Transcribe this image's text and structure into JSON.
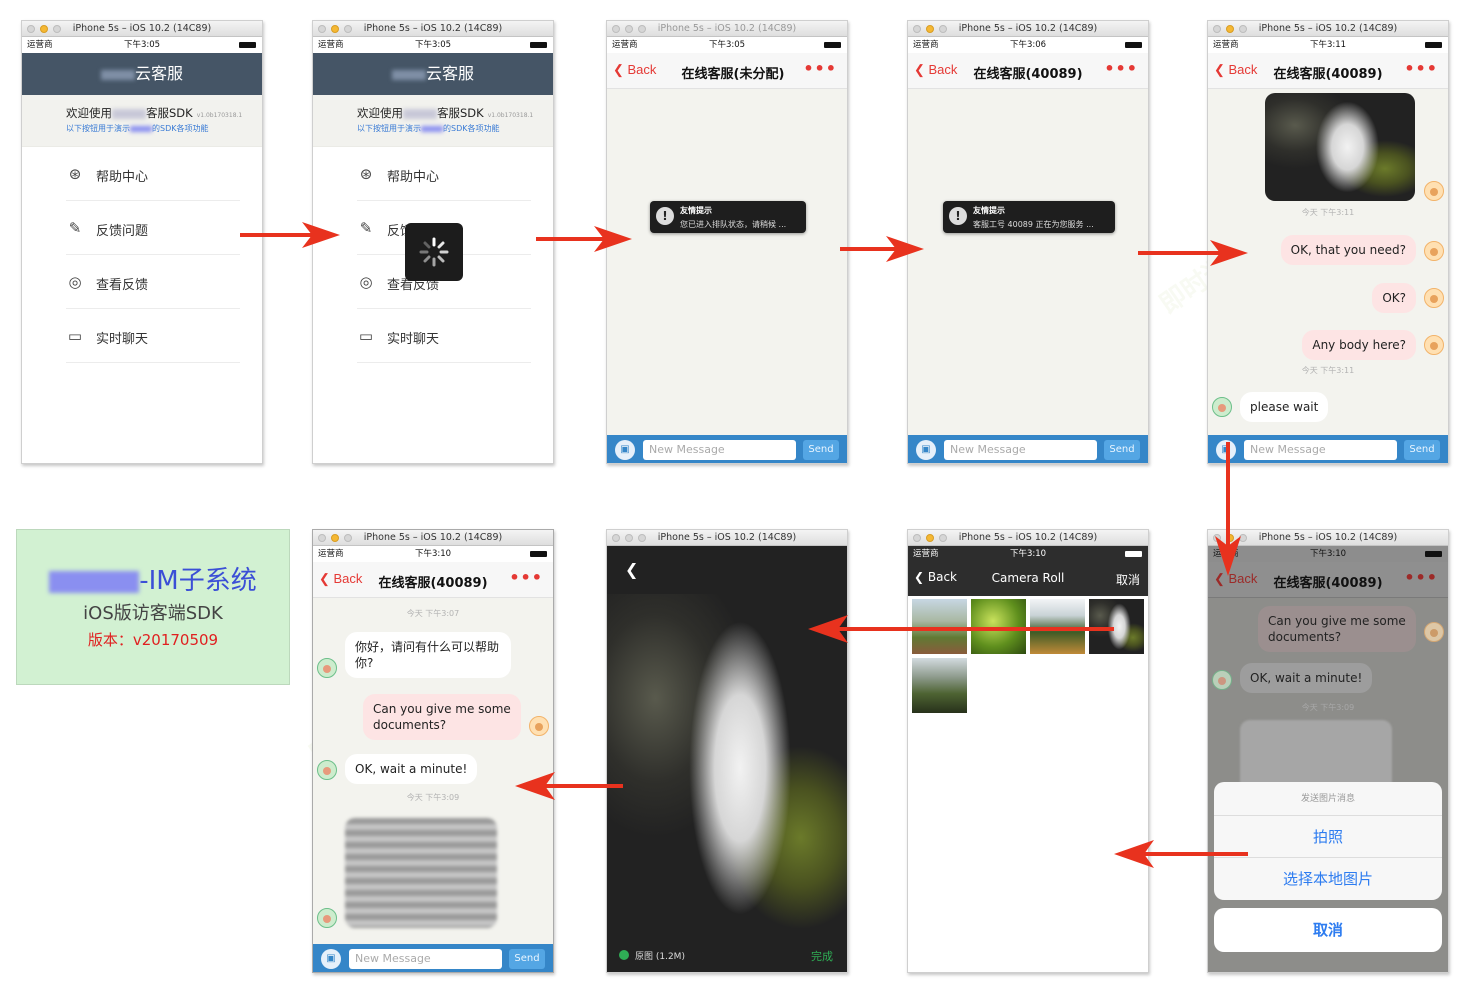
{
  "simulator_title": "iPhone 5s – iOS 10.2 (14C89)",
  "carrier": "运营商",
  "times": [
    "下午3:05",
    "下午3:05",
    "下午3:05",
    "下午3:06",
    "下午3:11",
    "下午3:10",
    "下午3:10",
    "下午3:10"
  ],
  "nav": {
    "back": "Back",
    "title_unassigned": "在线客服(未分配)",
    "title_assigned": "在线客服(40089)",
    "more": "•••"
  },
  "home": {
    "header_suffix": "云客服",
    "welcome_prefix": "欢迎使用",
    "welcome_suffix": "客服SDK",
    "version_small": "v1.0b170318.1",
    "subtitle_prefix": "以下按钮用于演示",
    "subtitle_suffix": "的SDK各项功能",
    "menu": [
      {
        "label": "帮助中心",
        "icon": "help-center-icon",
        "glyph": "⊛"
      },
      {
        "label": "反馈问题",
        "icon": "feedback-pen-icon",
        "glyph": "✎"
      },
      {
        "label": "查看反馈",
        "icon": "view-feedback-icon",
        "glyph": "◎"
      },
      {
        "label": "实时聊天",
        "icon": "live-chat-icon",
        "glyph": "▭"
      }
    ]
  },
  "input_bar": {
    "placeholder": "New Message",
    "send": "Send"
  },
  "toast_title": "友情提示",
  "toast_queue": "您已进入排队状态，请稍候 ...",
  "toast_assigned": "客服工号 40089 正在为您服务 ...",
  "chat5": {
    "ts1": "今天 下午3:11",
    "msg1": "OK, that you need?",
    "msg2": "OK?",
    "msg3": "Any body here?",
    "ts2": "今天 下午3:11",
    "msg4": "please wait"
  },
  "action_sheet": {
    "title": "发送图片消息",
    "take_photo": "拍照",
    "choose_local": "选择本地图片",
    "cancel": "取消"
  },
  "camera_roll": {
    "back": "Back",
    "title": "Camera Roll",
    "cancel": "取消"
  },
  "preview": {
    "original_label": "原图 (1.2M)",
    "done": "完成"
  },
  "chat9": {
    "ts1": "今天 下午3:07",
    "msg1": "你好，请问有什么可以帮助你?",
    "msg2": "Can you give me some documents?",
    "msg3": "OK, wait a minute!",
    "ts2": "今天 下午3:09"
  },
  "sdk_card": {
    "title_suffix": "-IM子系统",
    "subtitle": "iOS版访客端SDK",
    "version": "版本：v20170509"
  },
  "colors": {
    "accent_red": "#e53935",
    "nav_dark": "#455566",
    "input_blue": "#3586c8",
    "card_green": "#d2f1d2"
  }
}
